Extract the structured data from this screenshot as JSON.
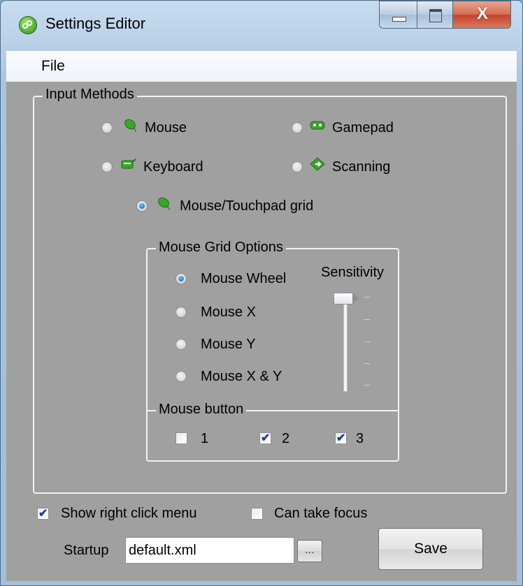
{
  "window": {
    "title": "Settings Editor",
    "close_glyph": "X"
  },
  "menu": {
    "file": "File"
  },
  "input_methods": {
    "legend": "Input Methods",
    "options": [
      {
        "label": "Mouse",
        "icon": "mouse-icon",
        "checked": false
      },
      {
        "label": "Gamepad",
        "icon": "gamepad-icon",
        "checked": false
      },
      {
        "label": "Keyboard",
        "icon": "keyboard-icon",
        "checked": false
      },
      {
        "label": "Scanning",
        "icon": "scanning-icon",
        "checked": false
      },
      {
        "label": "Mouse/Touchpad grid",
        "icon": "touchpad-grid-icon",
        "checked": true
      }
    ]
  },
  "mouse_grid_options": {
    "legend": "Mouse Grid Options",
    "modes": [
      {
        "label": "Mouse Wheel",
        "checked": true
      },
      {
        "label": "Mouse X",
        "checked": false
      },
      {
        "label": "Mouse Y",
        "checked": false
      },
      {
        "label": "Mouse X & Y",
        "checked": false
      }
    ],
    "sensitivity_label": "Sensitivity",
    "sensitivity_level": 1.0,
    "mouse_button_legend": "Mouse button",
    "mouse_buttons": [
      {
        "label": "1",
        "checked": false
      },
      {
        "label": "2",
        "checked": true
      },
      {
        "label": "3",
        "checked": true
      }
    ]
  },
  "show_right_click_menu": {
    "label": "Show right click menu",
    "checked": true
  },
  "can_take_focus": {
    "label": "Can take focus",
    "checked": false
  },
  "startup": {
    "label": "Startup",
    "value": "default.xml",
    "browse_label": "..."
  },
  "save_label": "Save",
  "colors": {
    "client_bg": "#a0a0a0",
    "accent": "#0b5ea8",
    "icon_green": "#3aa52a"
  }
}
